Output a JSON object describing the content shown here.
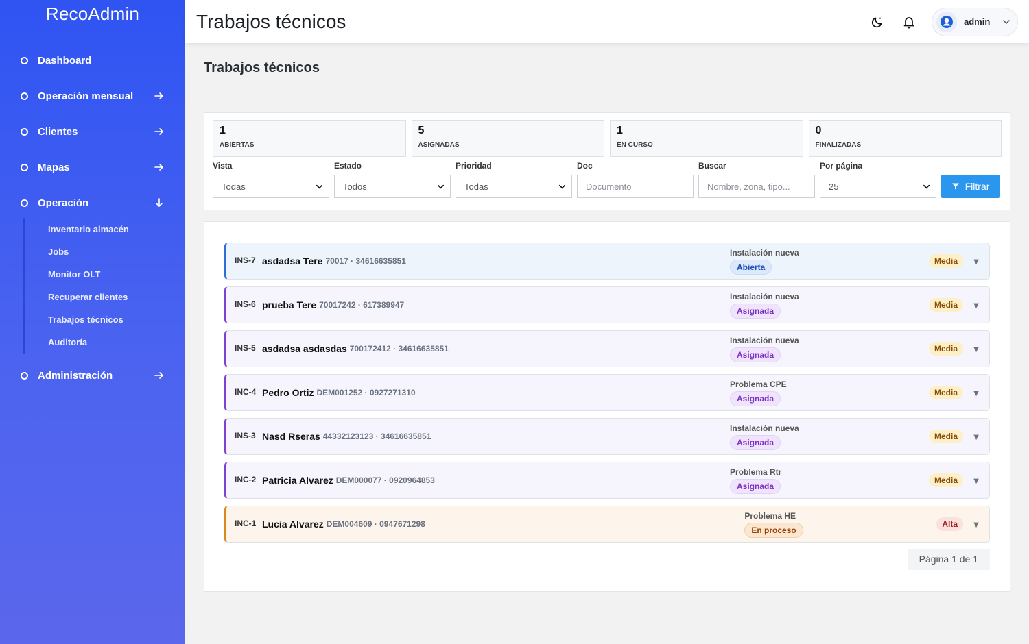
{
  "app": {
    "brand": "RecoAdmin",
    "header_title": "Trabajos técnicos"
  },
  "user": {
    "name": "admin"
  },
  "sidebar": {
    "items": [
      {
        "label": "Dashboard",
        "arrow": "none"
      },
      {
        "label": "Operación mensual",
        "arrow": "right"
      },
      {
        "label": "Clientes",
        "arrow": "right"
      },
      {
        "label": "Mapas",
        "arrow": "right"
      },
      {
        "label": "Operación",
        "arrow": "down"
      },
      {
        "label": "Administración",
        "arrow": "right"
      }
    ],
    "subitems": [
      "Inventario almacén",
      "Jobs",
      "Monitor OLT",
      "Recuperar clientes",
      "Trabajos técnicos",
      "Auditoría"
    ]
  },
  "page": {
    "title": "Trabajos técnicos"
  },
  "stats": [
    {
      "value": "1",
      "label": "ABIERTAS"
    },
    {
      "value": "5",
      "label": "ASIGNADAS"
    },
    {
      "value": "1",
      "label": "EN CURSO"
    },
    {
      "value": "0",
      "label": "FINALIZADAS"
    }
  ],
  "filters": {
    "vista": {
      "label": "Vista",
      "value": "Todas"
    },
    "estado": {
      "label": "Estado",
      "value": "Todos"
    },
    "prioridad": {
      "label": "Prioridad",
      "value": "Todas"
    },
    "doc": {
      "label": "Doc",
      "placeholder": "Documento"
    },
    "buscar": {
      "label": "Buscar",
      "placeholder": "Nombre, zona, tipo..."
    },
    "por_pagina": {
      "label": "Por página",
      "value": "25"
    },
    "button": "Filtrar"
  },
  "jobs": [
    {
      "code": "INS-7",
      "name": "asdadsa Tere",
      "meta": "70017 · 34616635851",
      "type": "Instalación nueva",
      "status": "Abierta",
      "priority": "Media"
    },
    {
      "code": "INS-6",
      "name": "prueba Tere",
      "meta": "70017242 · 617389947",
      "type": "Instalación nueva",
      "status": "Asignada",
      "priority": "Media"
    },
    {
      "code": "INS-5",
      "name": "asdadsa asdasdas",
      "meta": "700172412 · 34616635851",
      "type": "Instalación nueva",
      "status": "Asignada",
      "priority": "Media"
    },
    {
      "code": "INC-4",
      "name": "Pedro Ortiz",
      "meta": "DEM001252 · 0927271310",
      "type": "Problema CPE",
      "status": "Asignada",
      "priority": "Media"
    },
    {
      "code": "INS-3",
      "name": "Nasd Rseras",
      "meta": "44332123123 · 34616635851",
      "type": "Instalación nueva",
      "status": "Asignada",
      "priority": "Media"
    },
    {
      "code": "INC-2",
      "name": "Patricia Alvarez",
      "meta": "DEM000077 · 0920964853",
      "type": "Problema Rtr",
      "status": "Asignada",
      "priority": "Media"
    },
    {
      "code": "INC-1",
      "name": "Lucia Alvarez",
      "meta": "DEM004609 · 0947671298",
      "type": "Problema HE",
      "status": "En proceso",
      "priority": "Alta"
    }
  ],
  "pagination": {
    "text": "Página 1 de 1"
  },
  "colors": {
    "sidebar_top": "#2f54f2",
    "sidebar_bottom": "#5b67ec",
    "accent": "#2a96ee",
    "assigned": "#7f3fd0",
    "open": "#2b6fd6",
    "in_progress": "#d98a1e"
  }
}
